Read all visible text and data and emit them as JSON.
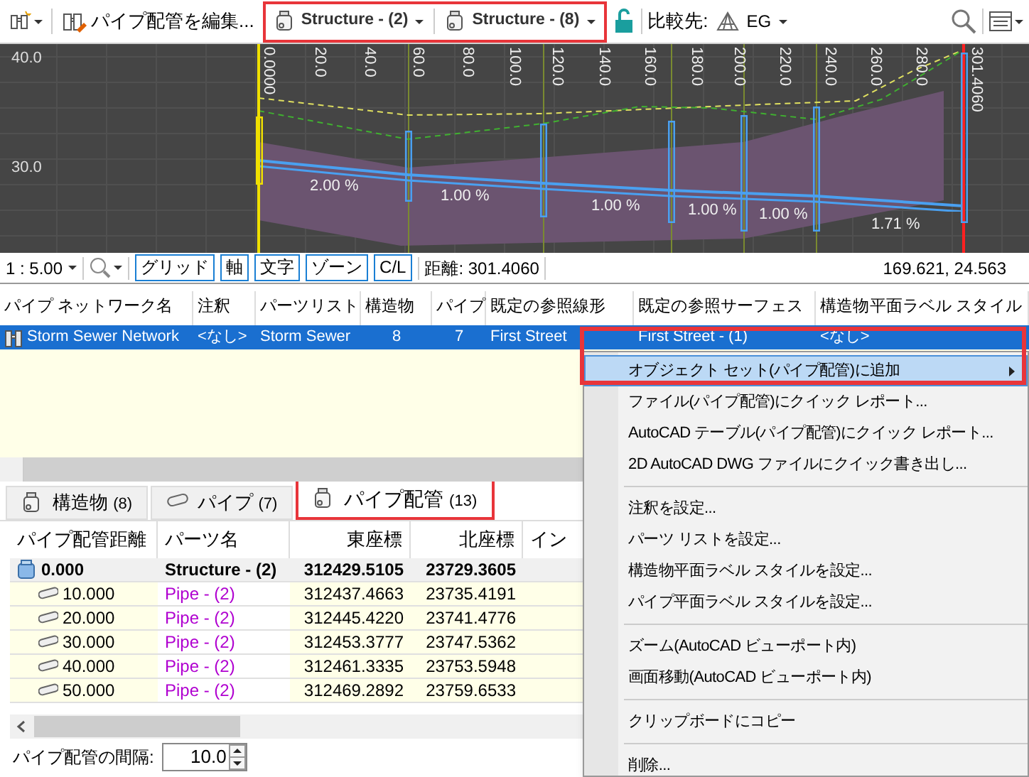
{
  "toolbar": {
    "edit_label": "パイプ配管を編集...",
    "start_structure": "Structure - (2)",
    "end_structure": "Structure - (8)",
    "compare_label": "比較先:",
    "surface": "EG"
  },
  "profile": {
    "y_labels": [
      "40.0",
      "30.0"
    ],
    "stations": [
      "0.0000",
      "20.0",
      "40.0",
      "60.0",
      "80.0",
      "100.0",
      "120.0",
      "140.0",
      "160.0",
      "180.0",
      "200.0",
      "220.0",
      "240.0",
      "260.0",
      "280.0",
      "301.4060"
    ],
    "slopes": [
      "2.00 %",
      "1.00 %",
      "1.00 %",
      "1.00 %",
      "1.00 %",
      "1.71 %"
    ]
  },
  "view_bar": {
    "scale": "1 : 5.00",
    "toggles": [
      "グリッド",
      "軸",
      "文字",
      "ゾーン",
      "C/L"
    ],
    "distance": "距離: 301.4060",
    "coordinates": "169.621, 24.563"
  },
  "network_table": {
    "columns": [
      "パイプ ネットワーク名",
      "注釈",
      "パーツリスト",
      "構造物",
      "パイプ",
      "既定の参照線形",
      "既定の参照サーフェス",
      "構造物平面ラベル スタイル"
    ],
    "rows": [
      {
        "selected": true,
        "cells": [
          "Storm Sewer Network",
          "<なし>",
          "Storm Sewer",
          "8",
          "7",
          "First Street",
          "First Street - (1)",
          "<なし>"
        ]
      }
    ]
  },
  "tabs": [
    {
      "label": "構造物",
      "count": "(8)",
      "selected": false
    },
    {
      "label": "パイプ",
      "count": "(7)",
      "selected": false
    },
    {
      "label": "パイプ配管",
      "count": "(13)",
      "selected": true
    }
  ],
  "run_table": {
    "columns": [
      "パイプ配管距離",
      "パーツ名",
      "東座標",
      "北座標",
      "イン"
    ],
    "rows": [
      {
        "kind": "structure",
        "cells": [
          "0.000",
          "Structure - (2)",
          "312429.5105",
          "23729.3605"
        ]
      },
      {
        "kind": "pipe",
        "cells": [
          "10.000",
          "Pipe - (2)",
          "312437.4663",
          "23735.4191"
        ]
      },
      {
        "kind": "pipe",
        "cells": [
          "20.000",
          "Pipe - (2)",
          "312445.4220",
          "23741.4776"
        ]
      },
      {
        "kind": "pipe",
        "cells": [
          "30.000",
          "Pipe - (2)",
          "312453.3777",
          "23747.5362"
        ]
      },
      {
        "kind": "pipe",
        "cells": [
          "40.000",
          "Pipe - (2)",
          "312461.3335",
          "23753.5948"
        ]
      },
      {
        "kind": "pipe",
        "cells": [
          "50.000",
          "Pipe - (2)",
          "312469.2892",
          "23759.6533"
        ]
      }
    ]
  },
  "spacing": {
    "label": "パイプ配管の間隔:",
    "value": "10.0"
  },
  "context_menu": {
    "groups": [
      [
        {
          "label": "オブジェクト セット(パイプ配管)に追加",
          "selected": true,
          "submenu": true
        },
        {
          "label": "ファイル(パイプ配管)にクイック レポート...",
          "selected": false,
          "submenu": false
        },
        {
          "label": "AutoCAD テーブル(パイプ配管)にクイック レポート...",
          "selected": false,
          "submenu": false
        },
        {
          "label": "2D AutoCAD DWG ファイルにクイック書き出し...",
          "selected": false,
          "submenu": false
        }
      ],
      [
        {
          "label": "注釈を設定...",
          "selected": false,
          "submenu": false
        },
        {
          "label": "パーツ リストを設定...",
          "selected": false,
          "submenu": false
        },
        {
          "label": "構造物平面ラベル スタイルを設定...",
          "selected": false,
          "submenu": false
        },
        {
          "label": "パイプ平面ラベル スタイルを設定...",
          "selected": false,
          "submenu": false
        }
      ],
      [
        {
          "label": "ズーム(AutoCAD ビューポート内)",
          "selected": false,
          "submenu": false
        },
        {
          "label": "画面移動(AutoCAD ビューポート内)",
          "selected": false,
          "submenu": false
        }
      ],
      [
        {
          "label": "クリップボードにコピー",
          "selected": false,
          "submenu": false
        }
      ],
      [
        {
          "label": "削除...",
          "selected": false,
          "submenu": false
        }
      ]
    ]
  }
}
